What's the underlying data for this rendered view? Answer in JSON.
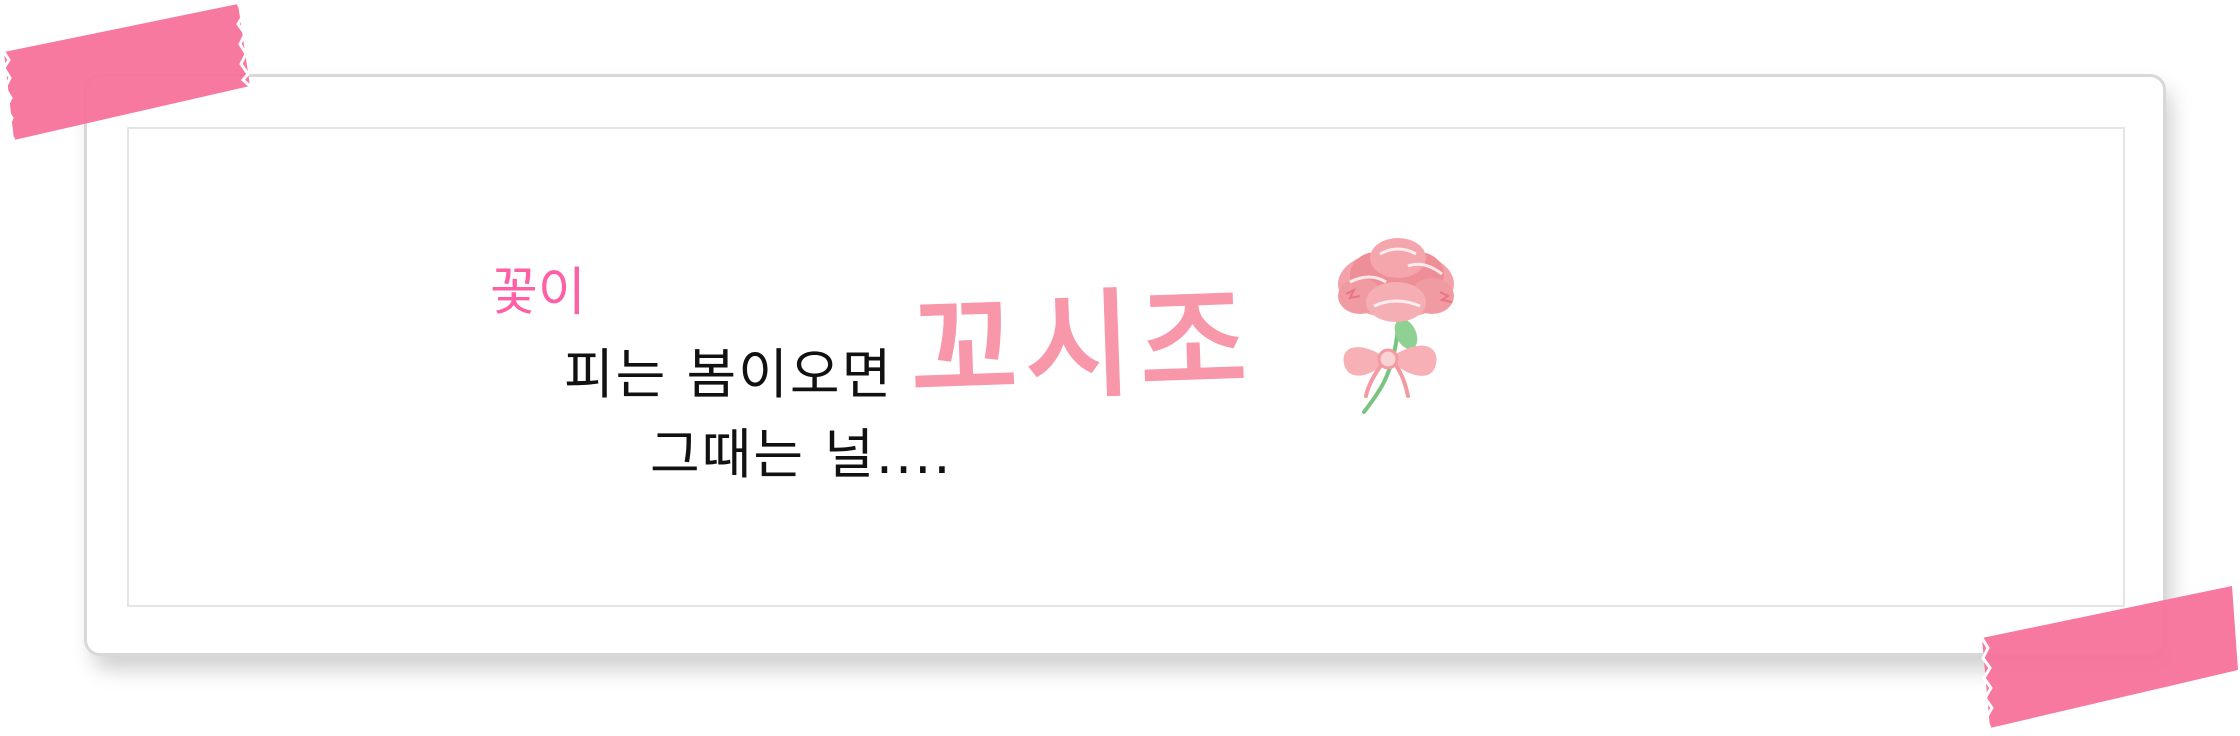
{
  "title": {
    "small_word": "꽃이",
    "line1": "피는 봄이오면",
    "line2": "그때는 널....",
    "brand": "꼬시조"
  },
  "icons": {
    "tape": "washi-tape-icon",
    "flower": "carnation-icon"
  },
  "colors": {
    "tape": "#f7729a",
    "brand": "#f896aa",
    "small_word": "#ff5fa5",
    "text": "#111111"
  }
}
